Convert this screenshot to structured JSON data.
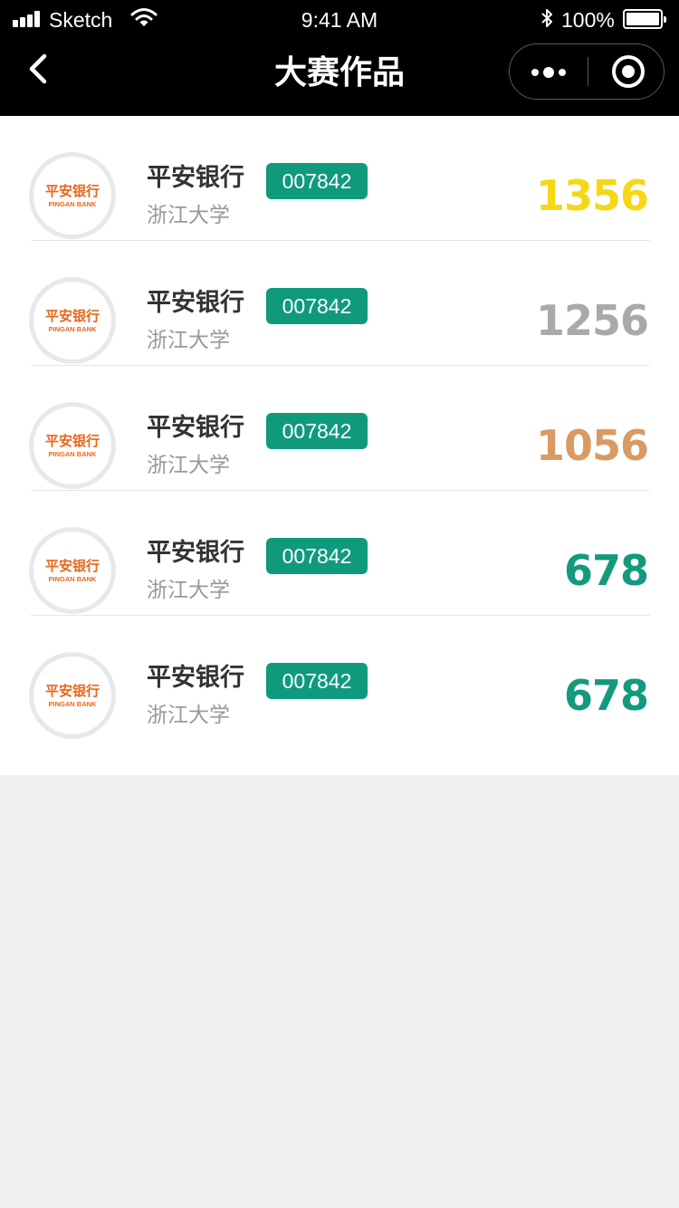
{
  "status_bar": {
    "carrier": "Sketch",
    "time": "9:41 AM",
    "battery": "100%",
    "icons": [
      "signal-icon",
      "wifi-icon",
      "bluetooth-icon",
      "battery-icon"
    ]
  },
  "nav": {
    "title": "大赛作品",
    "back_icon": "chevron-left-icon",
    "more_icon": "more-dots-icon",
    "close_icon": "target-circle-icon"
  },
  "logo": {
    "cn": "平安银行",
    "en": "PINGAN BANK"
  },
  "entries": [
    {
      "name": "平安银行",
      "code": "007842",
      "school": "浙江大学",
      "score": "1356",
      "score_color": "#f5d716"
    },
    {
      "name": "平安银行",
      "code": "007842",
      "school": "浙江大学",
      "score": "1256",
      "score_color": "#a9a9a9"
    },
    {
      "name": "平安银行",
      "code": "007842",
      "school": "浙江大学",
      "score": "1056",
      "score_color": "#d99a63"
    },
    {
      "name": "平安银行",
      "code": "007842",
      "school": "浙江大学",
      "score": "678",
      "score_color": "#139a7e"
    },
    {
      "name": "平安银行",
      "code": "007842",
      "school": "浙江大学",
      "score": "678",
      "score_color": "#139a7e"
    }
  ],
  "colors": {
    "header_bg": "#000000",
    "badge_bg": "#0f9a7d",
    "page_bg": "#f0f0f0",
    "logo_orange": "#e8661a"
  }
}
